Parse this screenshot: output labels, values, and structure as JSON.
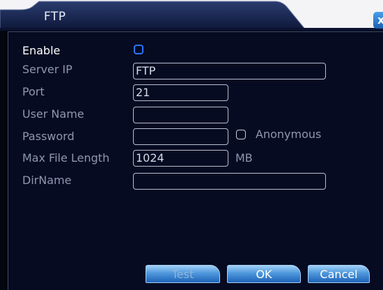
{
  "window": {
    "title": "FTP",
    "close_label": "x"
  },
  "form": {
    "enable_label": "Enable",
    "enable_checked": false,
    "server_ip_label": "Server IP",
    "server_ip_value": "FTP",
    "port_label": "Port",
    "port_value": "21",
    "user_name_label": "User Name",
    "user_name_value": "",
    "password_label": "Password",
    "password_value": "",
    "anonymous_label": "Anonymous",
    "anonymous_checked": false,
    "max_file_length_label": "Max File Length",
    "max_file_length_value": "1024",
    "max_file_length_unit": "MB",
    "dir_name_label": "DirName",
    "dir_name_value": ""
  },
  "buttons": {
    "test_label": "Test",
    "ok_label": "OK",
    "cancel_label": "Cancel"
  },
  "colors": {
    "background": "#060b22",
    "accent_blue": "#2d74ff",
    "label_gray": "#8e97ad"
  }
}
